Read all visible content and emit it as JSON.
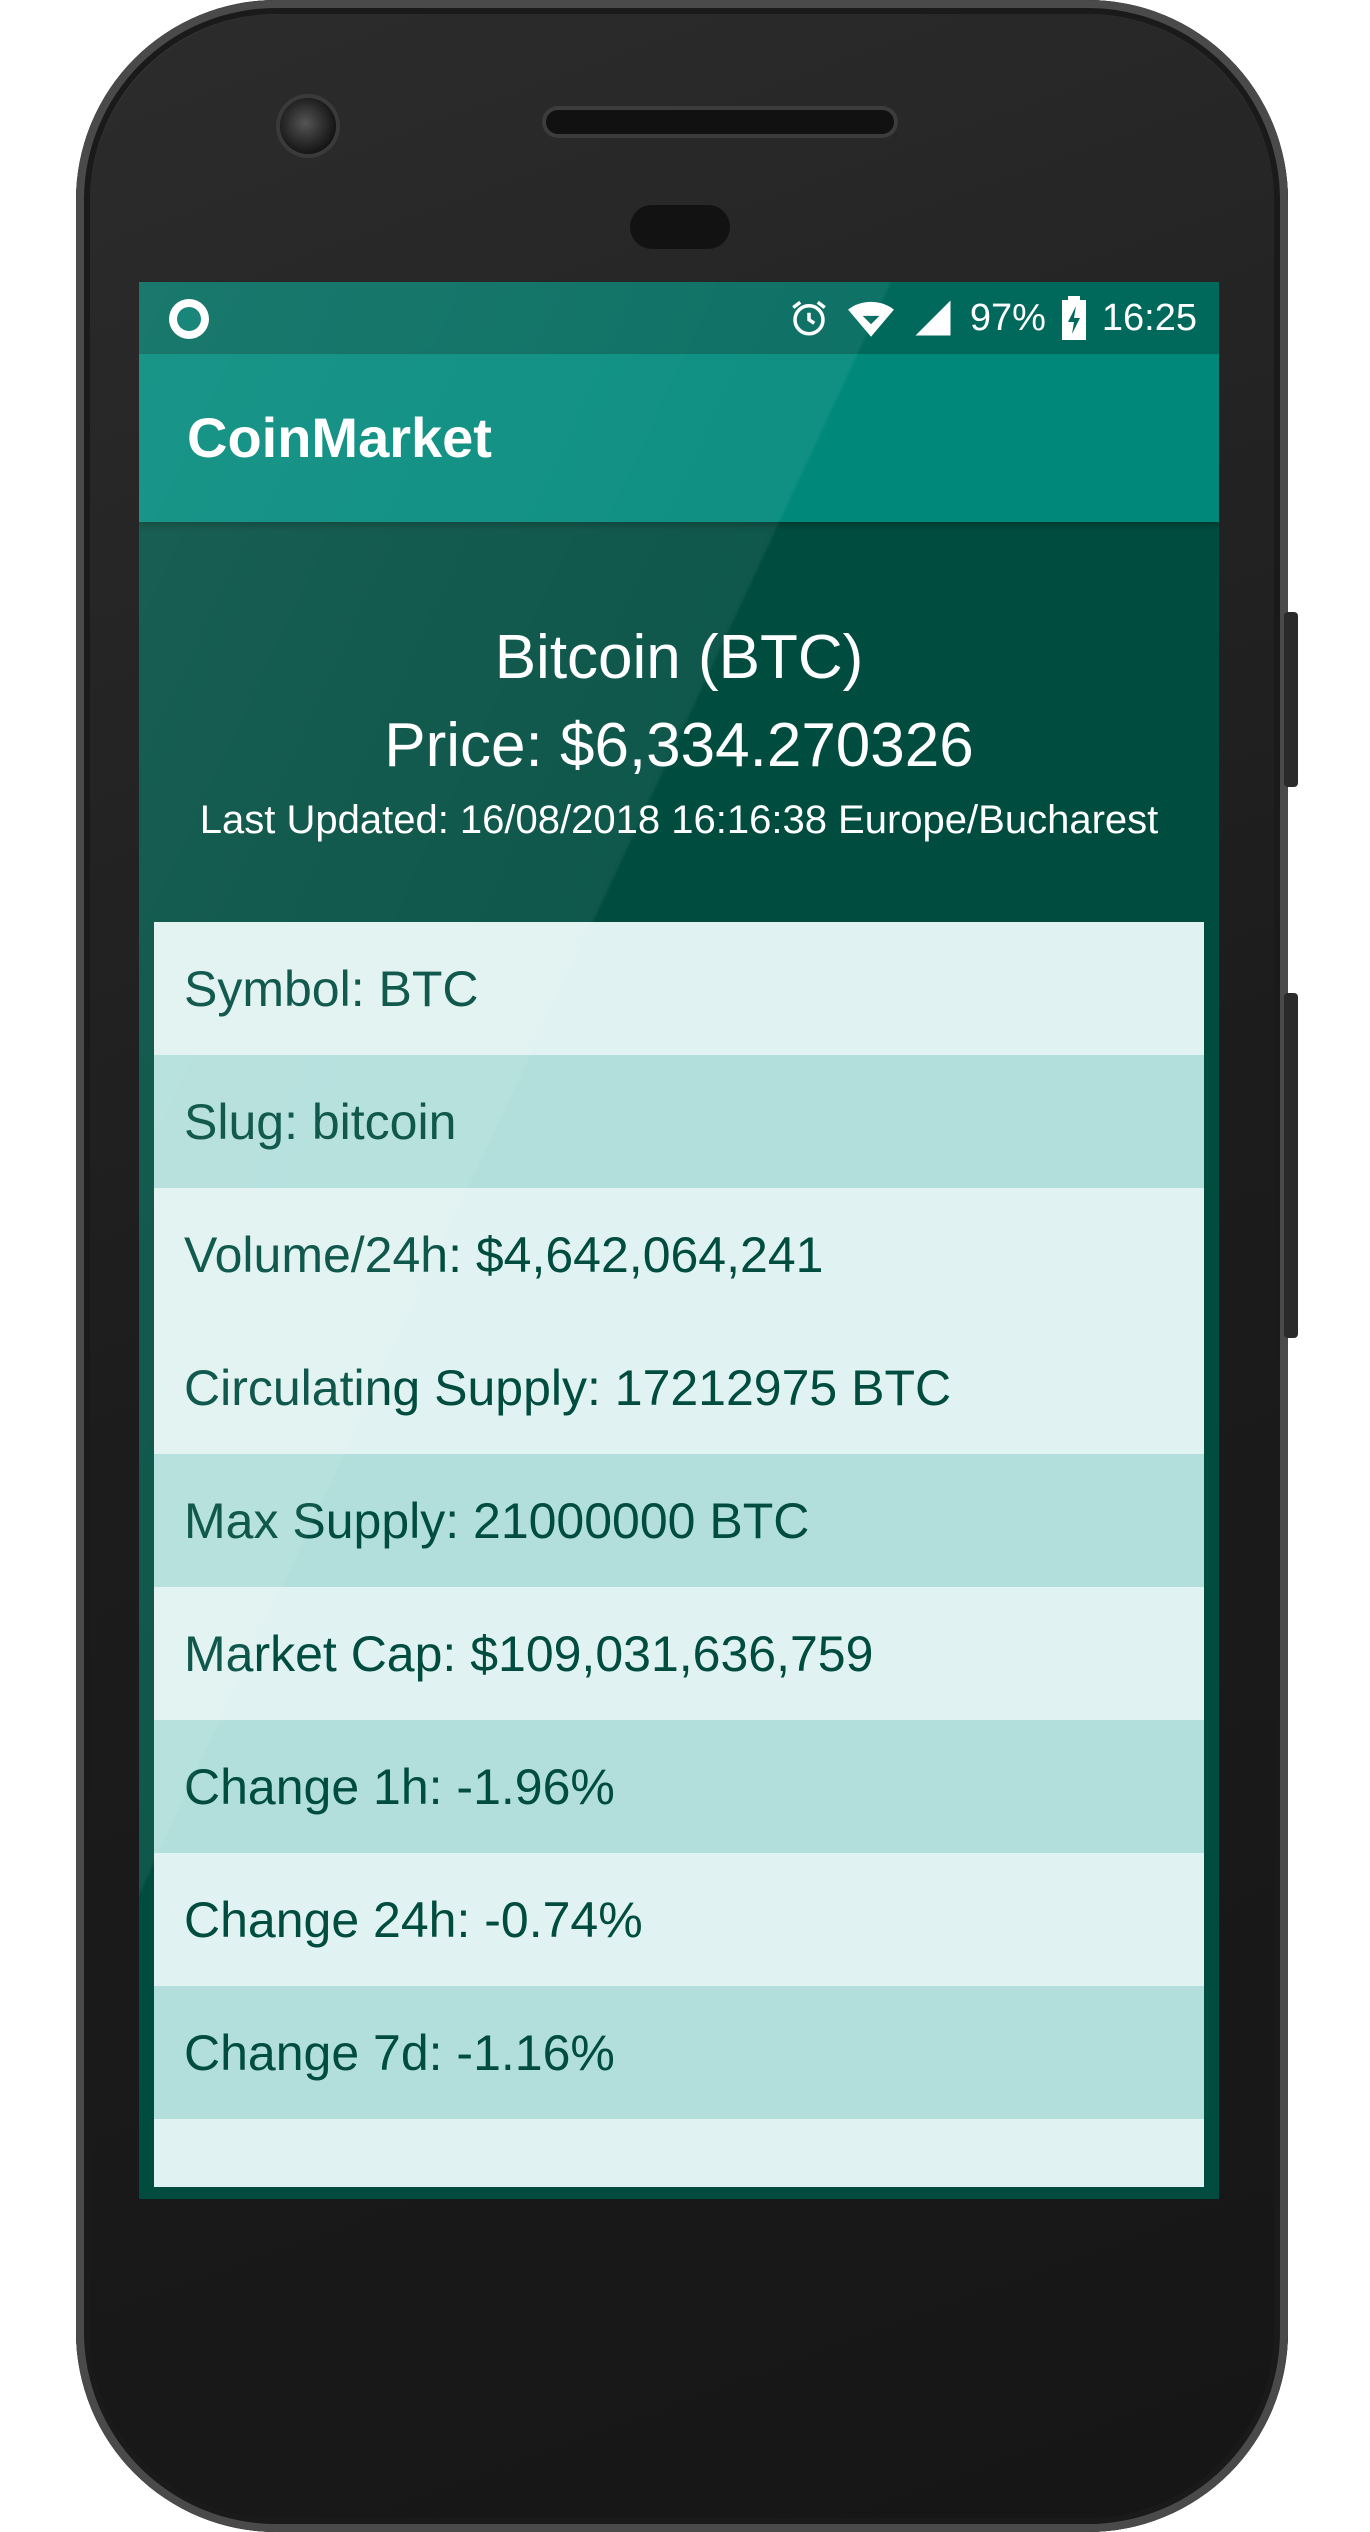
{
  "status_bar": {
    "battery": "97%",
    "time": "16:25",
    "icons": [
      "notification-dot-icon",
      "alarm-icon",
      "wifi-icon",
      "cell-signal-icon",
      "battery-charging-icon"
    ]
  },
  "app_bar": {
    "title": "CoinMarket"
  },
  "coin": {
    "name": "Bitcoin (BTC)",
    "price": "Price: $6,334.270326",
    "last_updated": "Last Updated: 16/08/2018 16:16:38 Europe/Bucharest"
  },
  "details": [
    {
      "label": "Symbol: BTC"
    },
    {
      "label": "Slug: bitcoin"
    },
    {
      "label": "Volume/24h: $4,642,064,241"
    },
    {
      "label": "Circulating Supply: 17212975 BTC"
    },
    {
      "label": "Max Supply: 21000000 BTC"
    },
    {
      "label": "Market Cap: $109,031,636,759"
    },
    {
      "label": "Change 1h: -1.96%"
    },
    {
      "label": "Change 24h: -0.74%"
    },
    {
      "label": "Change 7d: -1.16%"
    },
    {
      "label": ""
    }
  ],
  "colors": {
    "status_bar": "#00695c",
    "app_bar": "#00897b",
    "header_bg": "#004d40",
    "row_light": "#e0f2f1",
    "row_dark": "#b2dfdb",
    "row_text": "#004d40"
  }
}
